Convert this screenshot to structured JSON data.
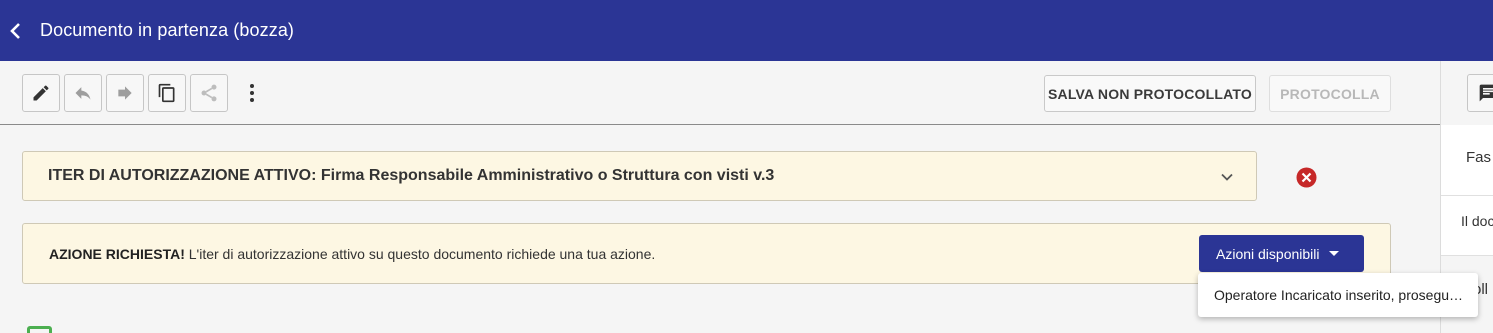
{
  "header": {
    "title": "Documento in partenza (bozza)"
  },
  "toolbar": {
    "icons": [
      "edit-icon",
      "reply-icon",
      "forward-icon",
      "copy-icon",
      "share-icon",
      "more-vert-icon"
    ],
    "salva_label": "SALVA NON PROTOCOLLATO",
    "protocolla_label": "PROTOCOLLA"
  },
  "iter": {
    "text": "ITER DI AUTORIZZAZIONE ATTIVO: Firma Responsabile Amministrativo o Struttura con visti v.3"
  },
  "azione": {
    "label": "AZIONE RICHIESTA!",
    "message": "L'iter di autorizzazione attivo su questo documento richiede una tua azione.",
    "button_label": "Azioni disponibili"
  },
  "dropdown": {
    "items": [
      "Operatore Incaricato inserito, proseguire"
    ]
  },
  "right_panel": {
    "fasc_text": "Fas",
    "doc_text": "Il doc",
    "oll_text": "oll"
  },
  "colors": {
    "header_bg": "#2b3595",
    "banner_bg": "#fdf7e3",
    "error_red": "#c62828",
    "check_green": "#4caf50"
  }
}
